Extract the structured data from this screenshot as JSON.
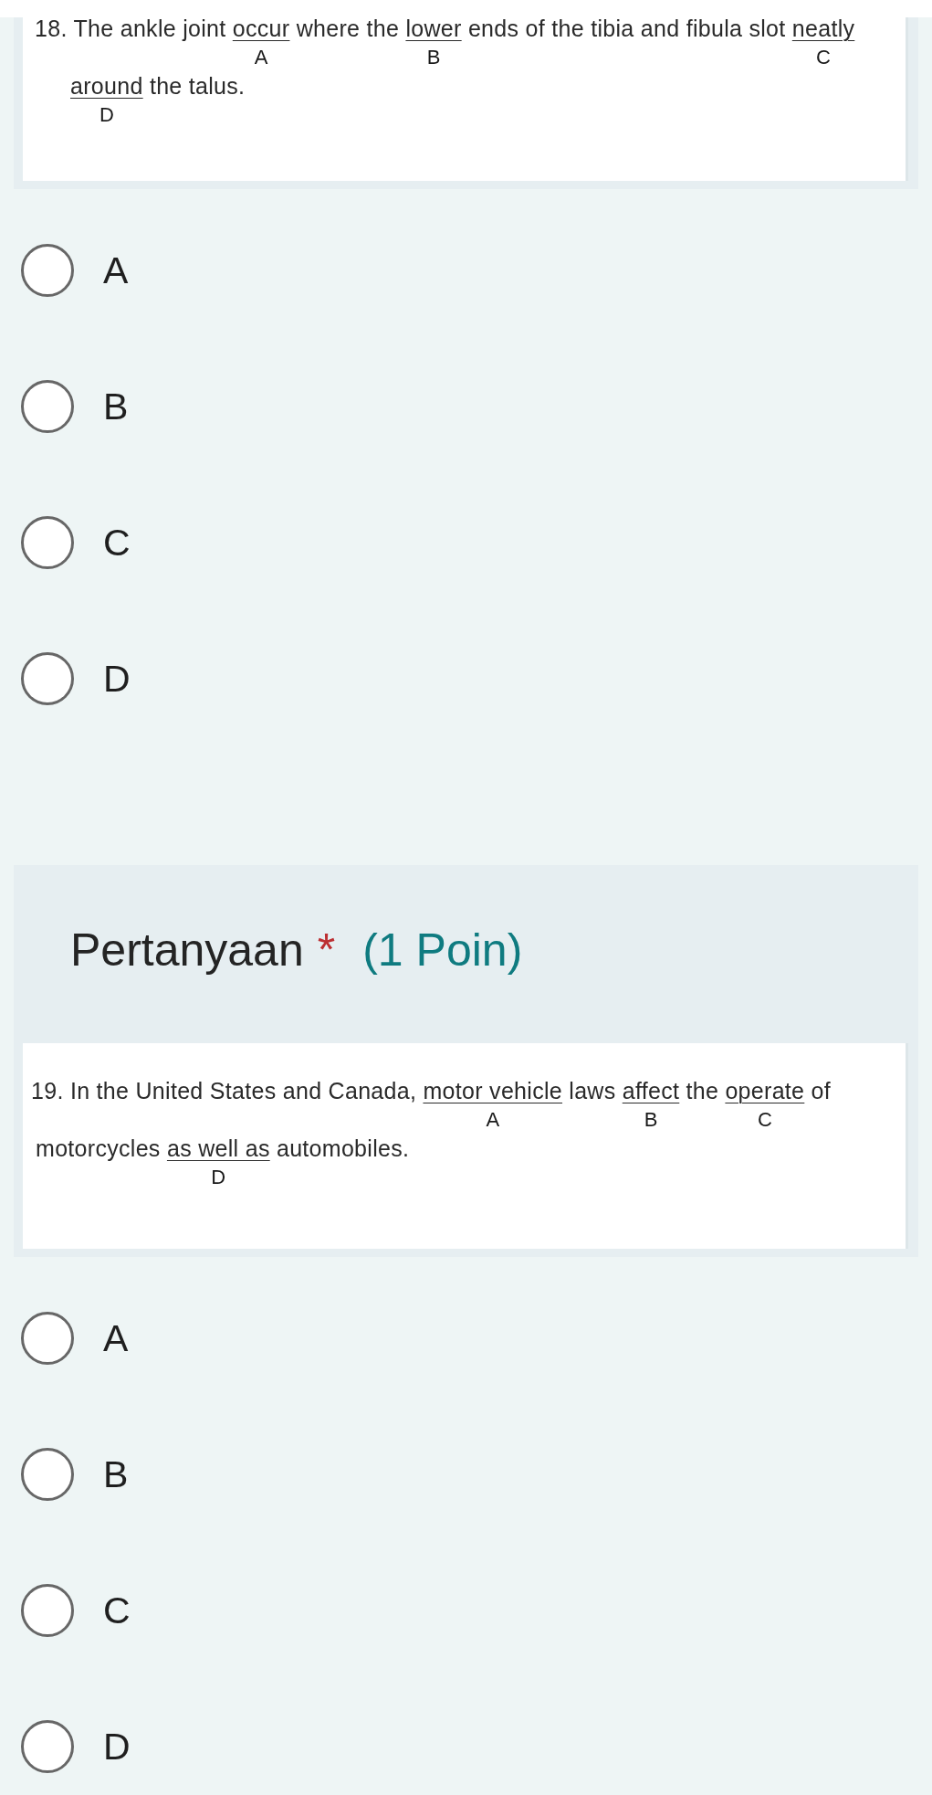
{
  "questions": [
    {
      "prompt": {
        "lines": [
          [
            {
              "kind": "plain",
              "text": "18. The ankle joint "
            },
            {
              "kind": "underlined",
              "text": "occur",
              "letter": "A"
            },
            {
              "kind": "plain",
              "text": " where the "
            },
            {
              "kind": "underlined",
              "text": "lower",
              "letter": "B"
            },
            {
              "kind": "plain",
              "text": " ends of the tibia and fibula slot "
            },
            {
              "kind": "underlined",
              "text": "neatly",
              "letter": "C"
            }
          ],
          [
            {
              "kind": "underlined",
              "text": "around",
              "letter": "D"
            },
            {
              "kind": "plain",
              "text": " the talus."
            }
          ]
        ]
      },
      "options": [
        {
          "label": "A",
          "selected": false
        },
        {
          "label": "B",
          "selected": false
        },
        {
          "label": "C",
          "selected": false
        },
        {
          "label": "D",
          "selected": false
        }
      ]
    },
    {
      "header": {
        "title": "Pertanyaan",
        "required_mark": "*",
        "points": "(1 Poin)"
      },
      "prompt": {
        "lines": [
          [
            {
              "kind": "plain",
              "text": "19. In the United States and Canada, "
            },
            {
              "kind": "underlined",
              "text": "motor vehicle",
              "letter": "A"
            },
            {
              "kind": "plain",
              "text": " laws "
            },
            {
              "kind": "underlined",
              "text": "affect",
              "letter": "B"
            },
            {
              "kind": "plain",
              "text": " the "
            },
            {
              "kind": "underlined",
              "text": "operate",
              "letter": "C"
            },
            {
              "kind": "plain",
              "text": " of"
            }
          ],
          [
            {
              "kind": "plain",
              "text": "motorcycles "
            },
            {
              "kind": "underlined",
              "text": "as well as",
              "letter": "D"
            },
            {
              "kind": "plain",
              "text": " automobiles."
            }
          ]
        ]
      },
      "options": [
        {
          "label": "A",
          "selected": false
        },
        {
          "label": "B",
          "selected": false
        },
        {
          "label": "C",
          "selected": false
        },
        {
          "label": "D",
          "selected": false
        }
      ]
    }
  ]
}
